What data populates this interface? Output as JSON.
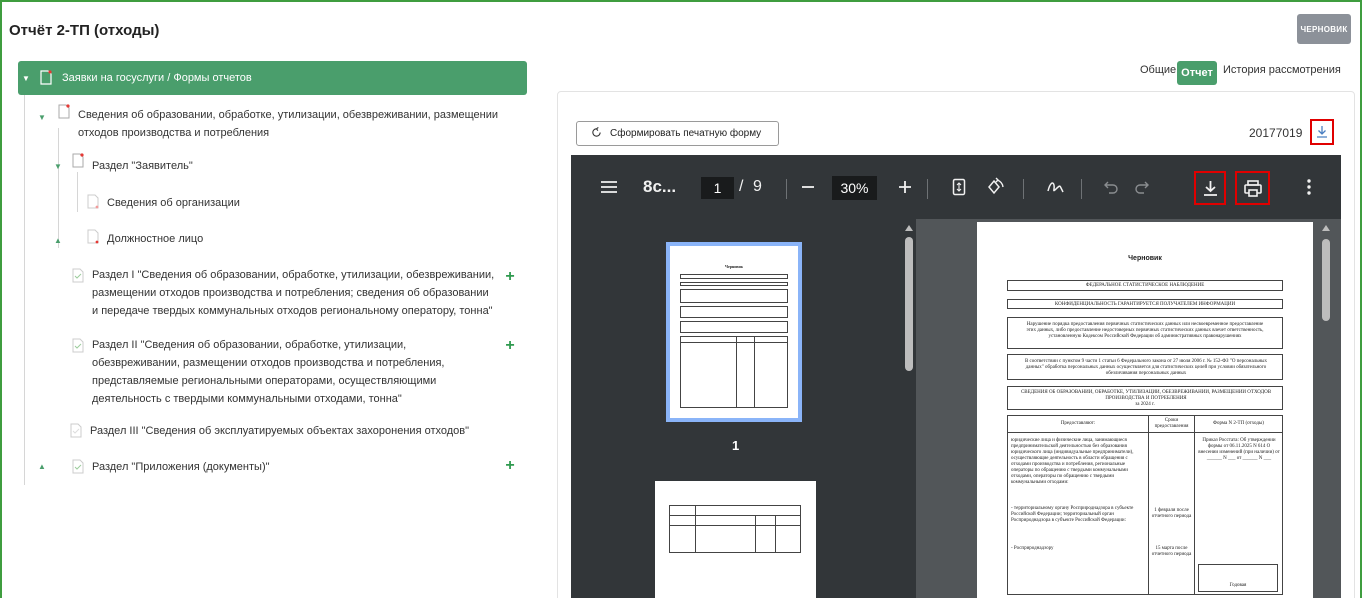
{
  "header": {
    "title": "Отчёт 2-ТП (отходы)",
    "status_badge": "ЧЕРНОВИК"
  },
  "tree": {
    "root": "Заявки на госуслуги / Формы отчетов",
    "node1": [
      "Сведения об образовании, обработке, утилизации, обезвреживании, размещении",
      "отходов производства и потребления"
    ],
    "node_applicant": "Раздел \"Заявитель\"",
    "node_org": "Сведения об организации",
    "node_official": "Должностное лицо",
    "node_sec1": [
      "Раздел I \"Сведения об образовании, обработке, утилизации, обезвреживании,",
      "размещении отходов производства и потребления; сведения об образовании",
      "и передаче твердых коммунальных отходов региональному оператору, тонна\""
    ],
    "node_sec2": [
      "Раздел II \"Сведения об образовании, обработке, утилизации,",
      "обезвреживании, размещении отходов производства и потребления,",
      "представляемые региональными операторами, осуществляющими",
      "деятельность с твердыми коммунальными отходами, тонна\""
    ],
    "node_sec3": "Раздел III \"Сведения об эксплуатируемых объектах захоронения отходов\"",
    "node_attach": "Раздел \"Приложения (документы)\""
  },
  "tabs": {
    "general": "Общие",
    "report": "Отчет",
    "history": "История рассмотрения"
  },
  "panel": {
    "generate_button": "Сформировать печатную форму",
    "document_number": "20177019"
  },
  "viewer": {
    "filename": "8c...",
    "current_page": "1",
    "page_separator": "/",
    "total_pages": "9",
    "zoom": "30%",
    "thumb_label": "1"
  },
  "document_page": {
    "watermark": "Черновик",
    "header1": "ФЕДЕРАЛЬНОЕ СТАТИСТИЧЕСКОЕ НАБЛЮДЕНИЕ",
    "header2": "КОНФИДЕНЦИАЛЬНОСТЬ ГАРАНТИРУЕТСЯ ПОЛУЧАТЕЛЕМ ИНФОРМАЦИИ",
    "notice": "Нарушение порядка предоставления первичных статистических данных или несвоевременное предоставление этих данных, либо предоставление недостоверных первичных статистических данных влечет ответственность, установленную Кодексом Российской Федерации об административных правонарушениях",
    "law": "В соответствии с пунктом 9 части 1 статьи 6 Федерального закона от 27 июля 2006 г. № 152-ФЗ \"О персональных данных\" обработка персональных данных осуществляется для статистических целей при условии обязательного обезличивания персональных данных",
    "form_title": "СВЕДЕНИЯ ОБ ОБРАЗОВАНИИ, ОБРАБОТКЕ, УТИЛИЗАЦИИ, ОБЕЗВРЕЖИВАНИИ, РАЗМЕЩЕНИИ ОТХОДОВ ПРОИЗВОДСТВА И ПОТРЕБЛЕНИЯ",
    "year": "за 2024 г.",
    "col1": "Предоставляют:",
    "col2": "Сроки предоставления",
    "col3": "Форма N 2-ТП (отходы)",
    "cell1": "юридические лица и физические лица, занимающиеся предпринимательской деятельностью без образования юридического лица (индивидуальные предприниматели), осуществляющие деятельность в области обращения с отходами производства и потребления, региональные операторы по обращению с твердыми коммунальными отходами, операторы по обращению с твердыми коммунальными отходами:",
    "cell1b": "- территориальному органу Росприроднадзора в субъекте Российской Федерации; территориальный орган Росприроднадзора в субъекте Российской Федерации:",
    "cell1c": "- Росприроднадзору",
    "cell2a": "1 февраля после отчетного периода",
    "cell2b": "15 марта после отчетного периода",
    "cell3": "Приказ Росстата: Об утверждении формы от 06.11.2025 N 614 О внесении изменений (при наличии) от ______ N ___ от ______ N ___",
    "cell3b": "Годовая"
  }
}
